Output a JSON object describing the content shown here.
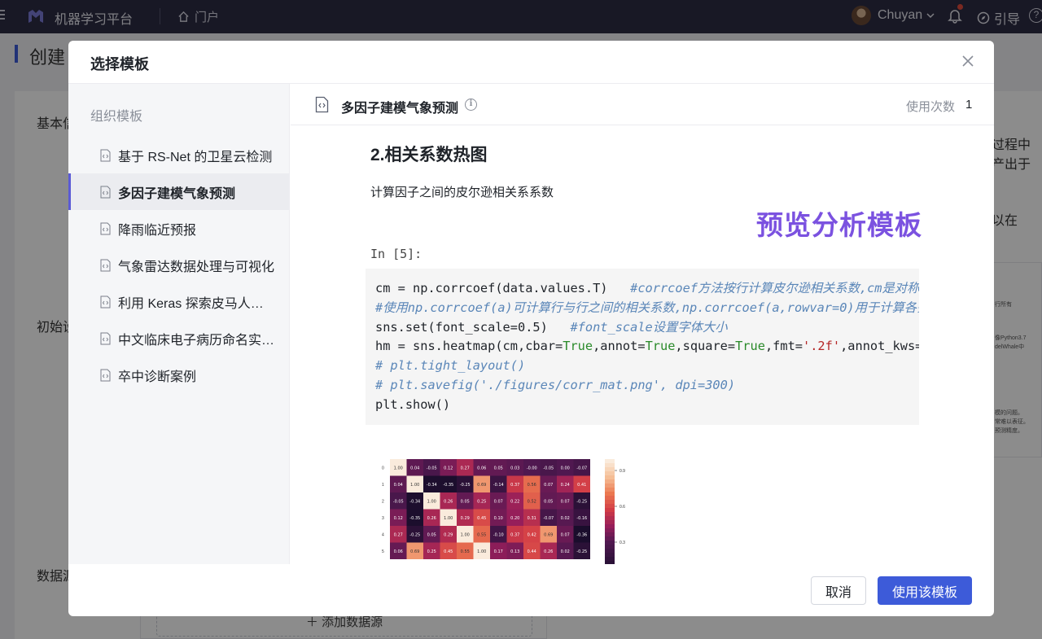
{
  "topbar": {
    "app_title": "机器学习平台",
    "portal_label": "门户",
    "user_name": "Chuyan",
    "guide_label": "引导"
  },
  "background": {
    "page_title": "创建",
    "label_basic": "基本信",
    "label_initial": "初始设",
    "label_datasource": "数据源",
    "right_text_1": "过程中",
    "right_text_2": "产出于",
    "right_text_3": "以在",
    "right_tiny_1": "行所有",
    "right_tiny_2": "像Python3.7",
    "right_tiny_3": "delWhale中",
    "right_tiny_4": "模的问题。",
    "right_tiny_5": "常难以表征。",
    "right_tiny_6": "预测精度。",
    "add_source": "添加数据源"
  },
  "modal": {
    "title": "选择模板",
    "sidebar_heading": "组织模板",
    "templates": [
      {
        "label": "基于 RS-Net 的卫星云检测"
      },
      {
        "label": "多因子建模气象预测"
      },
      {
        "label": "降雨临近预报"
      },
      {
        "label": "气象雷达数据处理与可视化"
      },
      {
        "label": "利用 Keras 探索皮马人…"
      },
      {
        "label": "中文临床电子病历命名实…"
      },
      {
        "label": "卒中诊断案例"
      }
    ],
    "selected": {
      "title": "多因子建模气象预测",
      "usage_label": "使用次数",
      "usage_count": "1"
    },
    "preview": {
      "heading": "2.相关系数热图",
      "paragraph": "计算因子之间的皮尔逊相关系系数",
      "badge": "预览分析模板",
      "prompt": "In [5]:"
    },
    "buttons": {
      "cancel": "取消",
      "use": "使用该模板"
    }
  },
  "heatmap": {
    "row_labels": [
      "0",
      "1",
      "2",
      "3",
      "4",
      "5"
    ],
    "rows": [
      [
        "1.00",
        "0.04",
        "-0.05",
        "0.12",
        "0.27",
        "0.06",
        "0.05",
        "0.03",
        "-0.00",
        "-0.05",
        "0.00",
        "-0.07"
      ],
      [
        "0.04",
        "1.00",
        "-0.34",
        "-0.35",
        "-0.25",
        "0.69",
        "-0.14",
        "0.37",
        "0.56",
        "0.07",
        "0.24",
        "0.41"
      ],
      [
        "-0.05",
        "-0.34",
        "1.00",
        "0.26",
        "0.05",
        "0.25",
        "0.07",
        "0.22",
        "0.52",
        "0.05",
        "0.07",
        "-0.25"
      ],
      [
        "0.12",
        "-0.35",
        "0.26",
        "1.00",
        "0.29",
        "0.45",
        "0.10",
        "0.20",
        "0.31",
        "-0.07",
        "0.02",
        "-0.16"
      ],
      [
        "0.27",
        "-0.25",
        "0.05",
        "0.29",
        "1.00",
        "0.55",
        "-0.10",
        "0.37",
        "0.42",
        "0.69",
        "0.07",
        "-0.36"
      ],
      [
        "0.06",
        "0.69",
        "0.25",
        "0.45",
        "0.55",
        "1.00",
        "0.17",
        "0.13",
        "0.44",
        "0.26",
        "0.02",
        "-0.25"
      ]
    ],
    "colorbar_ticks": [
      "0.9",
      "0.6",
      "0.3"
    ]
  },
  "colors": {
    "topbar": "#2d2c44",
    "accent": "#5b5bd6",
    "primary_button": "#3d5bd9",
    "badge": "#7b52e0"
  }
}
